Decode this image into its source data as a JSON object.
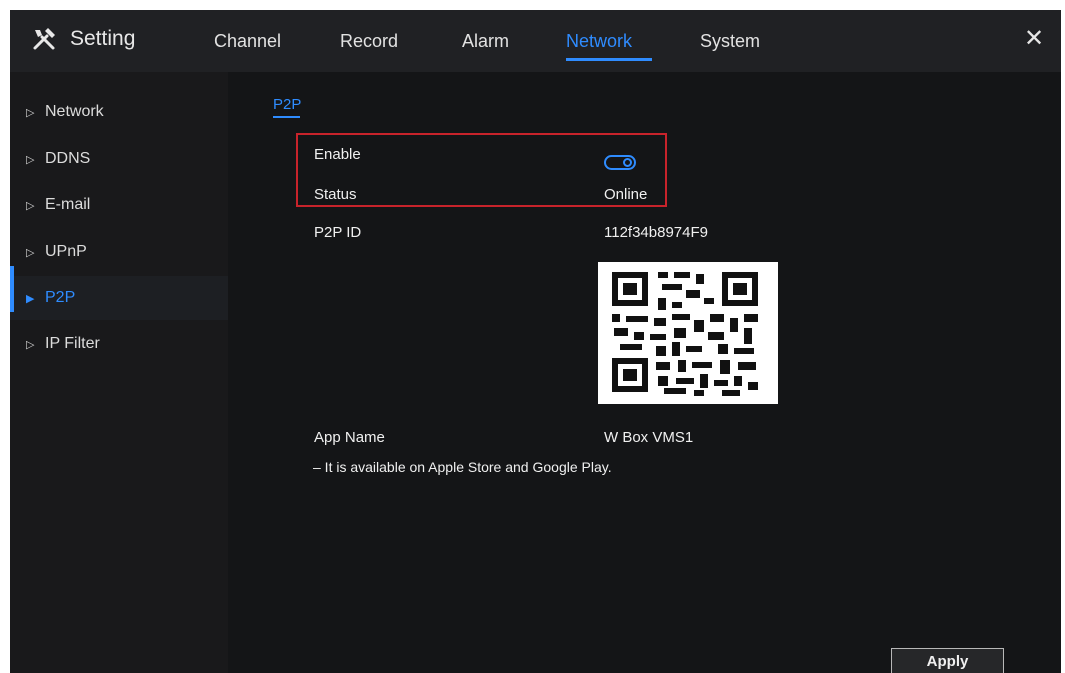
{
  "header": {
    "title": "Setting",
    "tabs": [
      "Channel",
      "Record",
      "Alarm",
      "Network",
      "System"
    ],
    "active_tab": "Network",
    "close_icon": "close-icon",
    "setting_icon": "tools-icon"
  },
  "sidebar": {
    "items": [
      {
        "label": "Network"
      },
      {
        "label": "DDNS"
      },
      {
        "label": "E-mail"
      },
      {
        "label": "UPnP"
      },
      {
        "label": "P2P",
        "active": true
      },
      {
        "label": "IP Filter"
      }
    ]
  },
  "content": {
    "subtab": "P2P",
    "enable_label": "Enable",
    "enable_value": true,
    "status_label": "Status",
    "status_value": "Online",
    "p2p_id_label": "P2P ID",
    "p2p_id_value": "112f34b8974F9",
    "app_name_label": "App Name",
    "app_name_value": "W Box VMS1",
    "note": "– It is available on Apple Store and Google Play."
  },
  "footer": {
    "apply_label": "Apply"
  },
  "colors": {
    "accent": "#2f8cff",
    "highlight": "#c8232b",
    "background": "#141517"
  }
}
